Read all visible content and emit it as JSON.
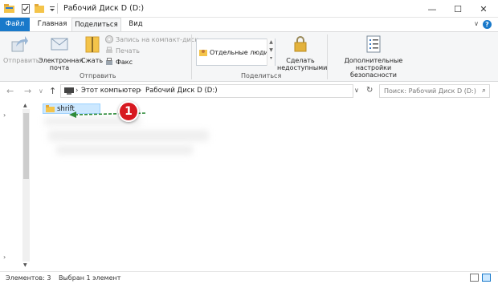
{
  "window": {
    "title": "Рабочий Диск D (D:)",
    "controls": {
      "minimize": "—",
      "maximize": "☐",
      "close": "✕"
    }
  },
  "quick_access": [
    "properties-icon",
    "folder-icon",
    "dropdown-icon"
  ],
  "tabs": [
    {
      "label": "Файл",
      "state": "file"
    },
    {
      "label": "Главная",
      "state": ""
    },
    {
      "label": "Поделиться",
      "state": "active"
    },
    {
      "label": "Вид",
      "state": ""
    }
  ],
  "help_label": "?",
  "ribbon": {
    "share_group": {
      "label": "Отправить",
      "send_label": "Отправить",
      "email_label_1": "Электронная",
      "email_label_2": "почта",
      "zip_label": "Сжать",
      "burn_label": "Запись на компакт-диск",
      "print_label": "Печать",
      "fax_label": "Факс"
    },
    "share_with_group": {
      "label": "Поделиться",
      "people_label": "Отдельные люди...",
      "stop_label_1": "Сделать",
      "stop_label_2": "недоступными"
    },
    "security": {
      "label_1": "Дополнительные",
      "label_2": "настройки безопасности"
    }
  },
  "address": {
    "crumbs": [
      "Этот компьютер",
      "Рабочий Диск D (D:)"
    ],
    "search_placeholder": "Поиск: Рабочий Диск D (D:)"
  },
  "content": {
    "items": [
      {
        "name": "shrift",
        "selected": true
      }
    ],
    "annotation_number": "1",
    "annotation_color": "#d71920",
    "arrow_color": "#2e8b3a"
  },
  "status": {
    "count": "Элементов: 3",
    "selected": "Выбран 1 элемент"
  },
  "colors": {
    "accent": "#1979ca",
    "selection": "#cce8ff",
    "ribbon_bg": "#f5f6f7"
  }
}
